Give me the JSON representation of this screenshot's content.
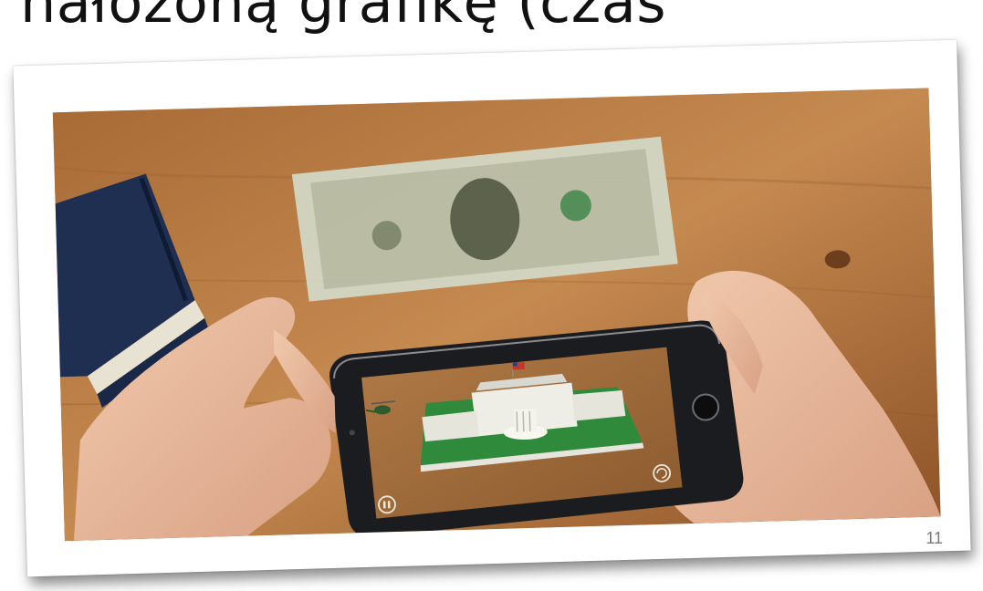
{
  "slide": {
    "heading": "nałożoną grafikę (czas",
    "slide_number": "11"
  },
  "colors": {
    "table_wood": "#b87a42",
    "phone_body": "#1b1c1f",
    "lawn_green": "#2f8a3b",
    "banknote": "#cfd6c3"
  },
  "icons": {
    "pause": "pause-icon",
    "camera": "camera-switch-icon"
  }
}
